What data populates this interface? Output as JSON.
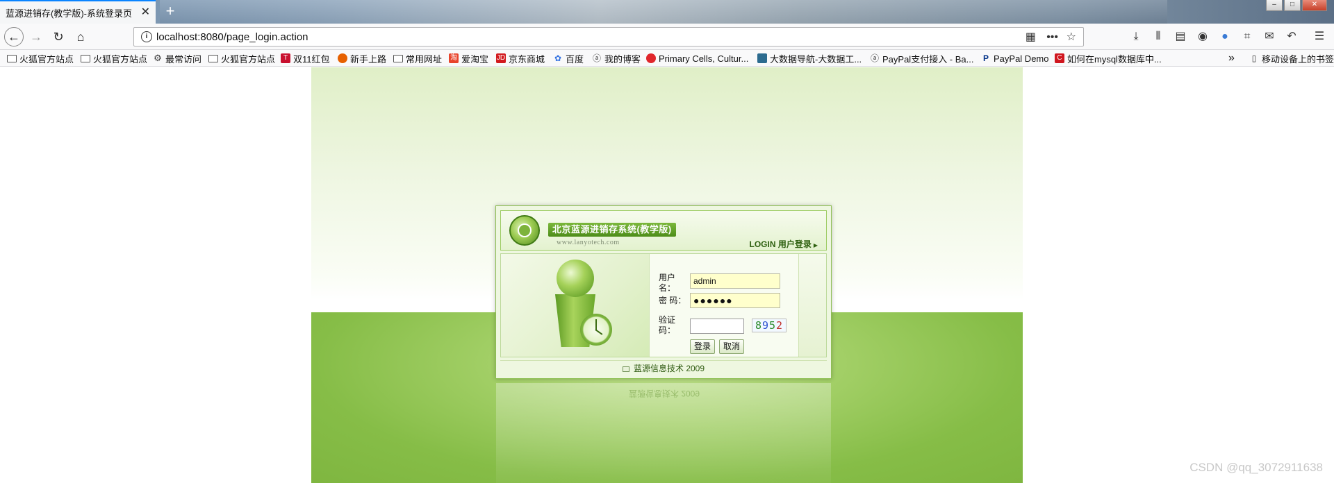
{
  "browser": {
    "tab_title": "蓝源进销存(教学版)-系统登录页",
    "tab_close": "✕",
    "new_tab": "+",
    "url": "localhost:8080/page_login.action",
    "bookmarks": [
      {
        "label": "火狐官方站点",
        "icon": "folder-icon"
      },
      {
        "label": "火狐官方站点",
        "icon": "folder-icon"
      },
      {
        "label": "最常访问",
        "icon": "gear-icon"
      },
      {
        "label": "火狐官方站点",
        "icon": "folder-icon"
      },
      {
        "label": "双11红包",
        "icon": "tmall-icon"
      },
      {
        "label": "新手上路",
        "icon": "firefox-icon"
      },
      {
        "label": "常用网址",
        "icon": "folder-icon"
      },
      {
        "label": "爱淘宝",
        "icon": "taobao-icon"
      },
      {
        "label": "京东商城",
        "icon": "jd-icon"
      },
      {
        "label": "百度",
        "icon": "baidu-icon"
      },
      {
        "label": "我的博客",
        "icon": "blog-icon"
      },
      {
        "label": "Primary Cells, Cultur...",
        "icon": "site-icon"
      },
      {
        "label": "大数据导航-大数据工...",
        "icon": "site-icon"
      },
      {
        "label": "PayPal支付接入 - Ba...",
        "icon": "blog-icon"
      },
      {
        "label": "PayPal Demo",
        "icon": "paypal-icon"
      },
      {
        "label": "如何在mysql数据库中...",
        "icon": "csdn-icon"
      }
    ],
    "overflow": "»",
    "mobile_bookmarks": "移动设备上的书签"
  },
  "login": {
    "system_title": "北京蓝源进销存系统(教学版)",
    "site_url": "www.lanyotech.com",
    "login_tag": "LOGIN 用户登录",
    "username_label": "用户名：",
    "username_value": "admin",
    "password_label": "密 码：",
    "password_value": "●●●●●●",
    "captcha_label": "验证码：",
    "captcha_value": "",
    "captcha_digits": [
      "8",
      "9",
      "5",
      "2"
    ],
    "login_button": "登录",
    "cancel_button": "取消",
    "footer": "蓝源信息技术 2009"
  },
  "watermark": "CSDN @qq_3072911638",
  "colors": {
    "accent": "#0a84ff",
    "theme_green": "#7fb640",
    "input_fill": "#ffffcc"
  }
}
